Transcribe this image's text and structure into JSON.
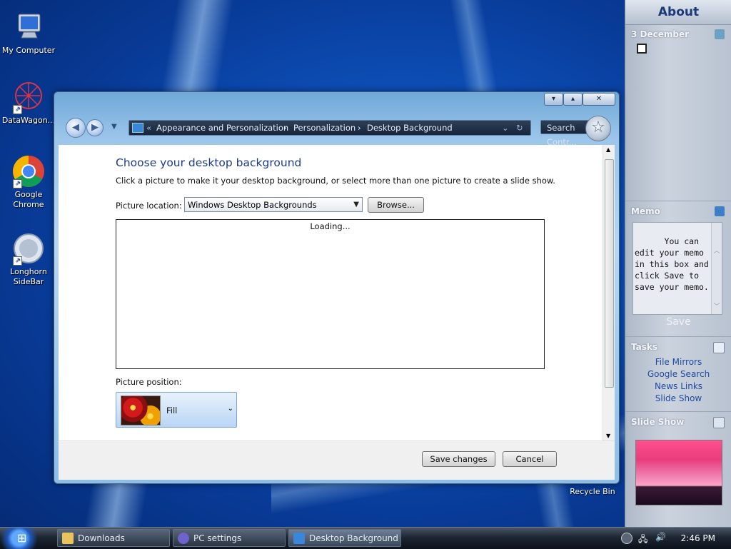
{
  "desktop": {
    "icons": [
      {
        "label": "My Computer"
      },
      {
        "label": "DataWagon..."
      },
      {
        "label": "Google Chrome"
      },
      {
        "label": "Longhorn SideBar"
      }
    ],
    "recycle_bin": "Recycle Bin"
  },
  "sidebar": {
    "about": "About",
    "clock_date": "3 December",
    "memo_title": "Memo",
    "memo_text": "You can edit your memo in this box and click Save to save your memo.",
    "save_label": "Save",
    "tasks_title": "Tasks",
    "tasks": [
      "File Mirrors",
      "Google Search",
      "News Links",
      "Slide Show"
    ],
    "slideshow_title": "Slide Show"
  },
  "window": {
    "address_prefix": "«",
    "breadcrumbs": [
      "Appearance and Personalization",
      "Personalization",
      "Desktop Background"
    ],
    "search_placeholder": "Search Contr...",
    "heading": "Choose your desktop background",
    "description": "Click a picture to make it your desktop background, or select more than one picture to create a slide show.",
    "picture_location_label": "Picture location:",
    "picture_location_value": "Windows Desktop Backgrounds",
    "browse_label": "Browse...",
    "loading_text": "Loading...",
    "picture_position_label": "Picture position:",
    "picture_position_value": "Fill",
    "save_changes_label": "Save changes",
    "cancel_label": "Cancel"
  },
  "taskbar": {
    "buttons": [
      "Downloads",
      "PC settings",
      "Desktop Background"
    ],
    "clock": "2:46 PM"
  },
  "colors": {
    "accent_blue": "#1e3a8a",
    "task_link": "#1f4a9e"
  }
}
